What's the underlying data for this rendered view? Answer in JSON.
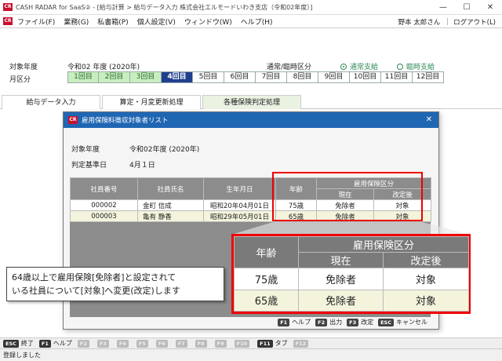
{
  "window": {
    "logo": "CR",
    "title": "CASH RADAR for SaaS② - [給与計算 > 給与データ入力 株式会社エルモードいわき支店（令和02年度）]",
    "minimize": "—",
    "maximize": "☐",
    "close": "✕"
  },
  "menu": {
    "items": [
      "ファイル(F)",
      "業務(G)",
      "私書箱(P)",
      "個人設定(V)",
      "ウィンドウ(W)",
      "ヘルプ(H)"
    ],
    "user": "野本 太郎さん",
    "logout": "ログアウト(L)",
    "separator": "|"
  },
  "header": {
    "year_label": "対象年度",
    "year_value": "令和02 年度 (2020年)",
    "month_label": "月区分",
    "pay_type_label": "通常/臨時区分",
    "pay_type_normal": "通常支給",
    "pay_type_extra": "臨時支給",
    "months": [
      {
        "label": "1回目",
        "state": "done"
      },
      {
        "label": "2回目",
        "state": "done"
      },
      {
        "label": "3回目",
        "state": "done"
      },
      {
        "label": "4回目",
        "state": "current"
      },
      {
        "label": "5回目",
        "state": "todo"
      },
      {
        "label": "6回目",
        "state": "todo"
      },
      {
        "label": "7回目",
        "state": "todo"
      },
      {
        "label": "8回目",
        "state": "todo"
      },
      {
        "label": "9回目",
        "state": "todo"
      },
      {
        "label": "10回目",
        "state": "todo"
      },
      {
        "label": "11回目",
        "state": "todo"
      },
      {
        "label": "12回目",
        "state": "todo"
      }
    ]
  },
  "tabs": [
    {
      "label": "給与データ入力",
      "active": false
    },
    {
      "label": "算定・月変更新処理",
      "active": false
    },
    {
      "label": "各種保険判定処理",
      "active": true
    }
  ],
  "dialog": {
    "logo": "CR",
    "title": "雇用保険料徴収対象者リスト",
    "close": "✕",
    "year_label": "対象年度",
    "year_value": "令和02年度 (2020年)",
    "date_label": "判定基準日",
    "date_value": "4月１日",
    "columns": {
      "id": "社員番号",
      "name": "社員氏名",
      "dob": "生年月日",
      "age": "年齢",
      "group": "雇用保険区分",
      "current": "現在",
      "after": "改定後"
    },
    "rows": [
      {
        "id": "000002",
        "name": "金町 信成",
        "dob": "昭和20年04月01日",
        "age": "75歳",
        "current": "免除者",
        "after": "対象"
      },
      {
        "id": "000003",
        "name": "亀有 静香",
        "dob": "昭和29年05月01日",
        "age": "65歳",
        "current": "免除者",
        "after": "対象"
      }
    ],
    "footer": [
      {
        "key": "F1",
        "label": "ヘルプ"
      },
      {
        "key": "F2",
        "label": "出力"
      },
      {
        "key": "F3",
        "label": "改定"
      },
      {
        "key": "ESC",
        "label": "キャンセル"
      }
    ]
  },
  "note": {
    "line1": "64歳以上で雇用保険[免除者]と設定されて",
    "line2": "いる社員について[対象]へ変更(改定)します"
  },
  "keybar": [
    {
      "key": "ESC",
      "label": "終了",
      "enabled": true
    },
    {
      "key": "F1",
      "label": "ヘルプ",
      "enabled": true
    },
    {
      "key": "F2",
      "label": "",
      "enabled": false
    },
    {
      "key": "F3",
      "label": "",
      "enabled": false
    },
    {
      "key": "F4",
      "label": "",
      "enabled": false
    },
    {
      "key": "F5",
      "label": "",
      "enabled": false
    },
    {
      "key": "F6",
      "label": "",
      "enabled": false
    },
    {
      "key": "F7",
      "label": "",
      "enabled": false
    },
    {
      "key": "F8",
      "label": "",
      "enabled": false
    },
    {
      "key": "F9",
      "label": "",
      "enabled": false
    },
    {
      "key": "F10",
      "label": "",
      "enabled": false
    },
    {
      "key": "F11",
      "label": "タブ",
      "enabled": true
    },
    {
      "key": "F12",
      "label": "",
      "enabled": false
    }
  ],
  "status": "登録しました",
  "colors": {
    "accent_blue": "#1f66b3",
    "current_month": "#1f3f8f",
    "done_month": "#c8eec0",
    "highlight_red": "#e00000",
    "radio_green": "#2e8b57"
  }
}
